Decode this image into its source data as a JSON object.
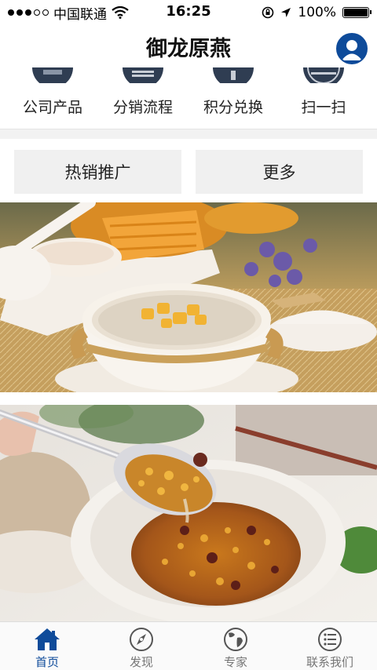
{
  "status_bar": {
    "carrier": "中国联通",
    "time": "16:25",
    "battery": "100%"
  },
  "header": {
    "title": "御龙原燕"
  },
  "quick_menu": [
    {
      "label": "公司产品",
      "icon": "product-icon"
    },
    {
      "label": "分销流程",
      "icon": "flow-icon"
    },
    {
      "label": "积分兑换",
      "icon": "points-icon"
    },
    {
      "label": "扫一扫",
      "icon": "scan-icon"
    }
  ],
  "buttons": {
    "hot_label": "热销推广",
    "more_label": "更多"
  },
  "banners": [
    {
      "name": "bird-nest-mango-bowl"
    },
    {
      "name": "bird-nest-spoon-bowl"
    }
  ],
  "tabbar": [
    {
      "label": "首页",
      "icon": "home-icon",
      "active": true
    },
    {
      "label": "发现",
      "icon": "compass-icon",
      "active": false
    },
    {
      "label": "专家",
      "icon": "globe-icon",
      "active": false
    },
    {
      "label": "联系我们",
      "icon": "list-icon",
      "active": false
    }
  ],
  "colors": {
    "accent": "#0e4b9a",
    "tab_inactive": "#777777",
    "button_bg": "#f0f0f0"
  }
}
